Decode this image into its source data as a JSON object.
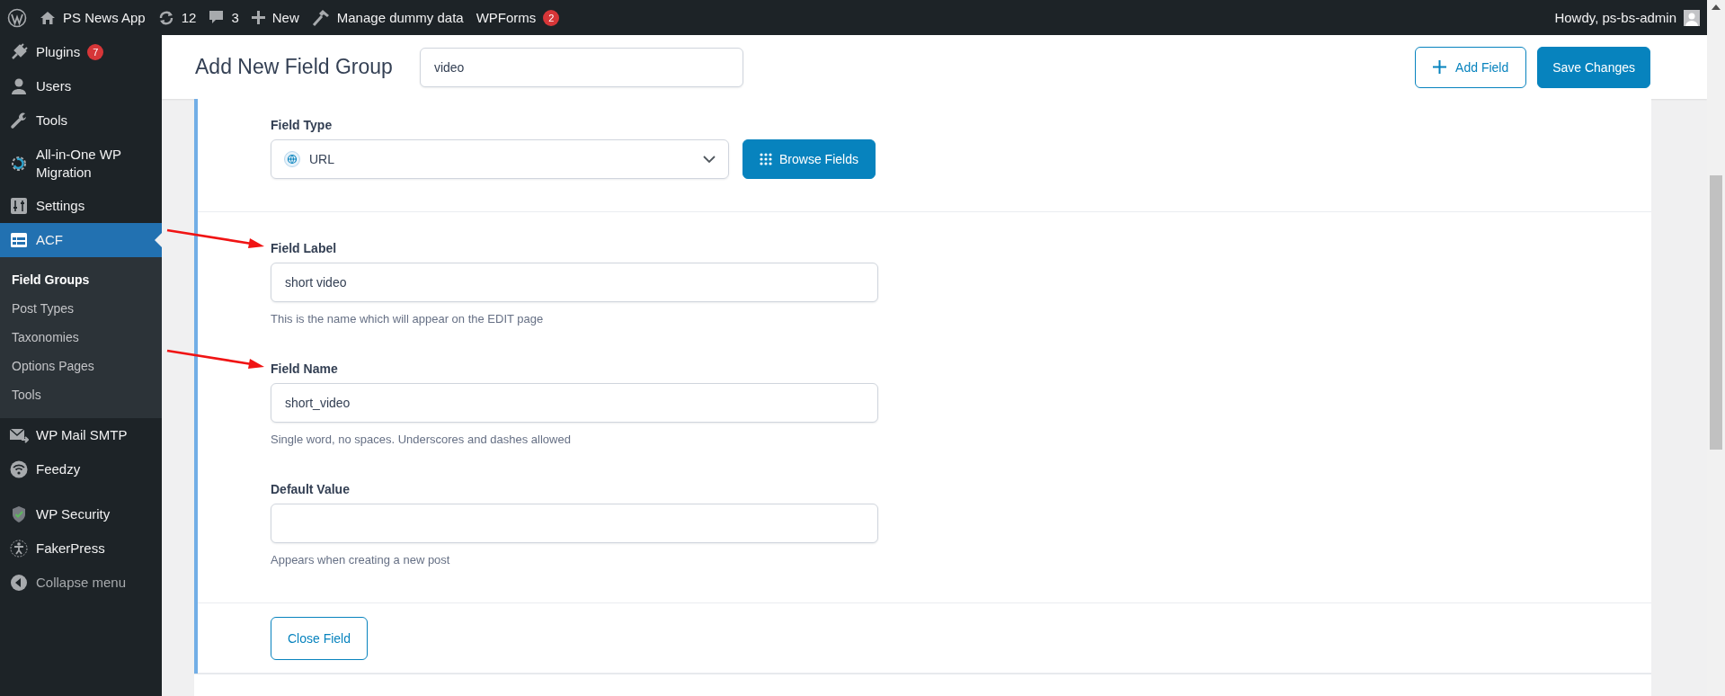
{
  "admin_bar": {
    "items": [
      {
        "kind": "wordpress"
      },
      {
        "kind": "home",
        "label": "PS News App"
      },
      {
        "kind": "updates",
        "label": "12"
      },
      {
        "kind": "comments",
        "label": "3"
      },
      {
        "kind": "new",
        "label": "New"
      },
      {
        "kind": "hammer",
        "label": "Manage dummy data"
      },
      {
        "kind": "plain",
        "label": "WPForms",
        "badge": "2"
      }
    ],
    "greeting": "Howdy, ps-bs-admin"
  },
  "sidebar": {
    "groups": [
      [
        {
          "kind": "plug",
          "label": "Plugins",
          "badge": "7",
          "selected": false
        },
        {
          "kind": "user",
          "label": "Users",
          "selected": false
        },
        {
          "kind": "wrench",
          "label": "Tools",
          "selected": false
        },
        {
          "kind": "migration",
          "label": "All-in-One WP Migration",
          "selected": false
        },
        {
          "kind": "settings",
          "label": "Settings",
          "selected": false
        },
        {
          "kind": "table",
          "label": "ACF",
          "selected": true,
          "submenu": [
            {
              "label": "Field Groups",
              "selected": true
            },
            {
              "label": "Post Types",
              "selected": false
            },
            {
              "label": "Taxonomies",
              "selected": false
            },
            {
              "label": "Options Pages",
              "selected": false
            },
            {
              "label": "Tools",
              "selected": false
            }
          ]
        },
        {
          "kind": "mail",
          "label": "WP Mail SMTP",
          "selected": false
        },
        {
          "kind": "wifi",
          "label": "Feedzy",
          "selected": false
        }
      ],
      [
        {
          "kind": "shield",
          "label": "WP Security",
          "selected": false
        },
        {
          "kind": "person",
          "label": "FakerPress",
          "selected": false
        },
        {
          "kind": "collapse",
          "label": "Collapse menu",
          "selected": false
        }
      ]
    ]
  },
  "header": {
    "title": "Add New Field Group",
    "group_name": "video",
    "add_button": "Add Field",
    "save_button": "Save Changes"
  },
  "field_type": {
    "label": "Field Type",
    "value": "URL",
    "button": "Browse Fields"
  },
  "fields": [
    {
      "label": "Field Label",
      "value": "short video",
      "help": "This is the name which will appear on the EDIT page",
      "annotated": true
    },
    {
      "label": "Field Name",
      "value": "short_video",
      "help": "Single word, no spaces. Underscores and dashes allowed",
      "annotated": true
    },
    {
      "label": "Default Value",
      "help": "Appears when creating a new post",
      "annotated": false
    }
  ],
  "close_button": "Close Field"
}
